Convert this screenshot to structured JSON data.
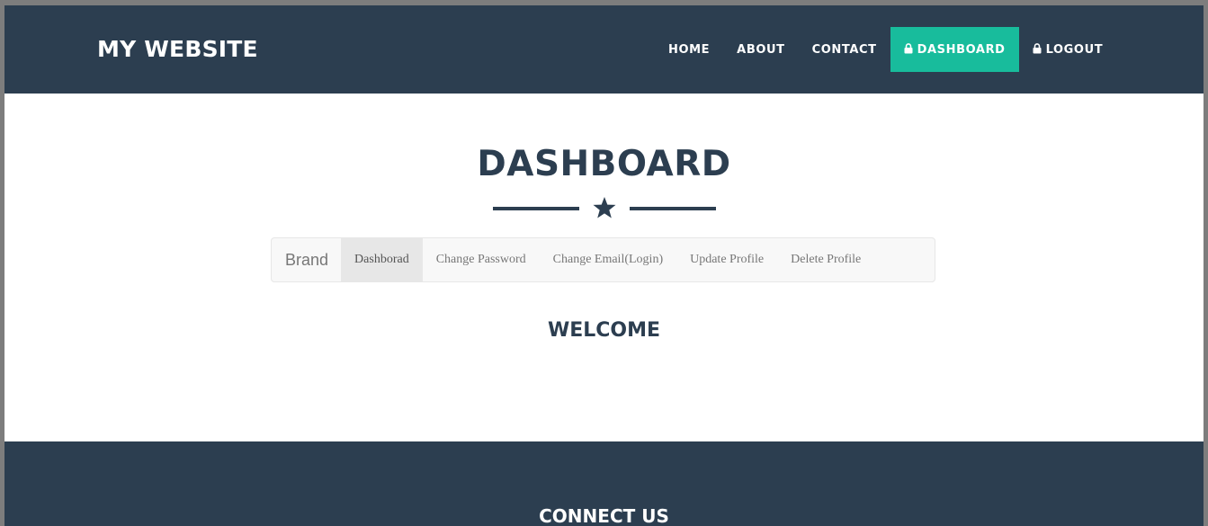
{
  "navbar": {
    "brand": "MY WEBSITE",
    "items": [
      {
        "label": "HOME",
        "icon": null,
        "active": false
      },
      {
        "label": "ABOUT",
        "icon": null,
        "active": false
      },
      {
        "label": "CONTACT",
        "icon": null,
        "active": false
      },
      {
        "label": "DASHBOARD",
        "icon": "lock-icon",
        "active": true
      },
      {
        "label": "LOGOUT",
        "icon": "lock-icon",
        "active": false
      }
    ]
  },
  "main": {
    "title": "DASHBOARD",
    "divider_icon": "star-icon",
    "subnav": {
      "brand": "Brand",
      "items": [
        {
          "label": "Dashborad",
          "active": true
        },
        {
          "label": "Change Password",
          "active": false
        },
        {
          "label": "Change Email(Login)",
          "active": false
        },
        {
          "label": "Update Profile",
          "active": false
        },
        {
          "label": "Delete Profile",
          "active": false
        }
      ]
    },
    "welcome": "WELCOME"
  },
  "footer": {
    "title": "CONNECT US"
  },
  "colors": {
    "primary": "#2c3e50",
    "accent": "#18bc9c",
    "white": "#ffffff"
  }
}
